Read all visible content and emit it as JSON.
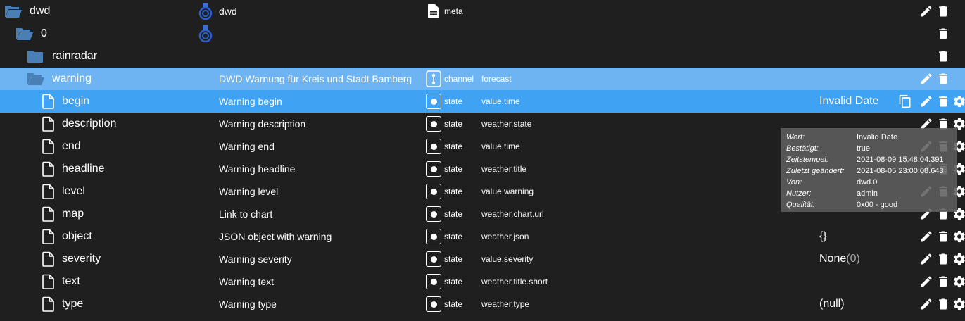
{
  "colors": {
    "background": "#1f1f1f",
    "channel_selected": "#6fb4f2",
    "state_selected": "#3fa2f2",
    "folder": "#4a7fb5",
    "icon": "#ffffff"
  },
  "tree": {
    "adapter": {
      "name": "dwd",
      "desc": "dwd",
      "type_label": "meta"
    },
    "instance": {
      "name": "0"
    },
    "rainradar": {
      "name": "rainradar"
    },
    "warning": {
      "name": "warning",
      "desc": "DWD Warnung für Kreis und Stadt Bamberg",
      "type_label": "channel",
      "role": "forecast"
    },
    "states": [
      {
        "name": "begin",
        "desc": "Warning begin",
        "type_label": "state",
        "role": "value.time",
        "value": "Invalid Date",
        "value_q": ""
      },
      {
        "name": "description",
        "desc": "Warning description",
        "type_label": "state",
        "role": "weather.state",
        "value": "",
        "value_q": ""
      },
      {
        "name": "end",
        "desc": "Warning end",
        "type_label": "state",
        "role": "value.time",
        "value": "",
        "value_q": ""
      },
      {
        "name": "headline",
        "desc": "Warning headline",
        "type_label": "state",
        "role": "weather.title",
        "value": "",
        "value_q": ""
      },
      {
        "name": "level",
        "desc": "Warning level",
        "type_label": "state",
        "role": "value.warning",
        "value": "",
        "value_q": ""
      },
      {
        "name": "map",
        "desc": "Link to chart",
        "type_label": "state",
        "role": "weather.chart.url",
        "value": "",
        "value_q": ""
      },
      {
        "name": "object",
        "desc": "JSON object with warning",
        "type_label": "state",
        "role": "weather.json",
        "value": "{}",
        "value_q": ""
      },
      {
        "name": "severity",
        "desc": "Warning severity",
        "type_label": "state",
        "role": "value.severity",
        "value": "None",
        "value_q": "(0)"
      },
      {
        "name": "text",
        "desc": "Warning text",
        "type_label": "state",
        "role": "weather.title.short",
        "value": "",
        "value_q": ""
      },
      {
        "name": "type",
        "desc": "Warning type",
        "type_label": "state",
        "role": "weather.type",
        "value": "(null)",
        "value_q": ""
      }
    ]
  },
  "tooltip": {
    "rows": [
      {
        "key": "Wert:",
        "val": "Invalid Date"
      },
      {
        "key": "Bestätigt:",
        "val": "true"
      },
      {
        "key": "Zeitstempel:",
        "val": "2021-08-09 15:48:04.391"
      },
      {
        "key": "Zuletzt geändert:",
        "val": "2021-08-05 23:00:08.643"
      },
      {
        "key": "Von:",
        "val": "dwd.0"
      },
      {
        "key": "Nutzer:",
        "val": "admin"
      },
      {
        "key": "Qualität:",
        "val": "0x00 - good"
      }
    ]
  }
}
